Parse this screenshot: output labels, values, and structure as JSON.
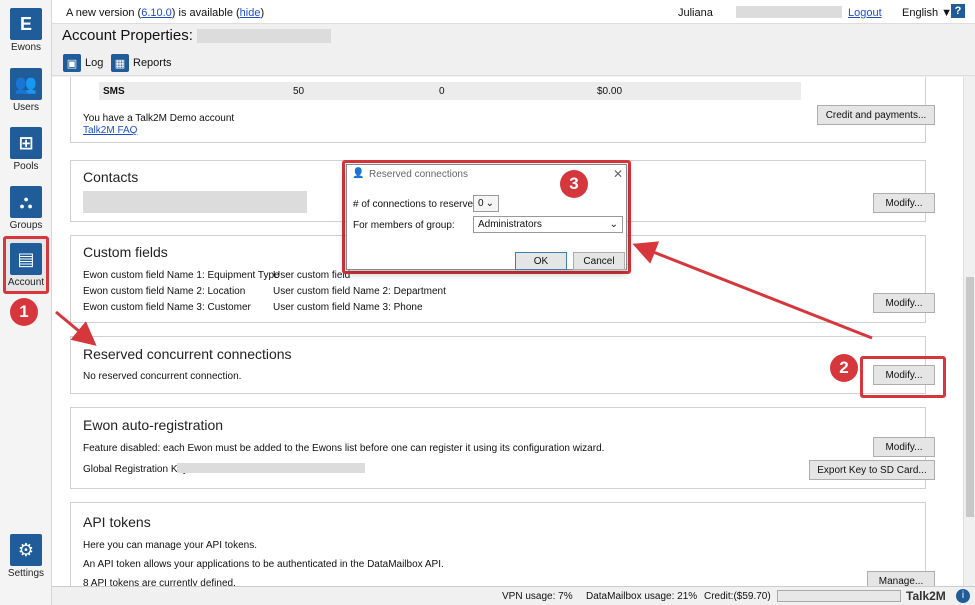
{
  "nav": [
    {
      "label": "Ewons",
      "icon": "ewons-logo-icon",
      "glyph": "E"
    },
    {
      "label": "Users",
      "icon": "users-icon",
      "glyph": "👥"
    },
    {
      "label": "Pools",
      "icon": "pools-icon",
      "glyph": "⊞"
    },
    {
      "label": "Groups",
      "icon": "groups-icon",
      "glyph": "⛬"
    },
    {
      "label": "Account",
      "icon": "account-icon",
      "glyph": "▤"
    },
    {
      "label": "Settings",
      "icon": "gear-icon",
      "glyph": "⚙"
    }
  ],
  "topbar": {
    "update_prefix": "A new version (",
    "version": "6.10.0",
    "update_suffix": ") is available (",
    "hide": "hide",
    "update_close": ")",
    "user": "Juliana",
    "logout": "Logout",
    "language": "English ▼",
    "help": "?"
  },
  "page_title": "Account Properties:",
  "toolbar": {
    "log": "Log",
    "reports": "Reports"
  },
  "sms_row": {
    "label": "SMS",
    "c1": "50",
    "c2": "0",
    "c3": "$0.00"
  },
  "talk2m": {
    "demo": "You have a Talk2M Demo account",
    "faq": "Talk2M FAQ",
    "credit_button": "Credit and payments..."
  },
  "contacts": {
    "title": "Contacts",
    "modify": "Modify..."
  },
  "custom_fields": {
    "title": "Custom fields",
    "ewon_fields": [
      "Ewon custom field Name 1: Equipment Type",
      "Ewon custom field Name 2: Location",
      "Ewon custom field Name 3: Customer"
    ],
    "user_fields": [
      "User custom field",
      "User custom field Name 2: Department",
      "User custom field Name 3: Phone"
    ],
    "modify": "Modify..."
  },
  "reserved": {
    "title": "Reserved concurrent connections",
    "text": "No reserved concurrent connection.",
    "modify": "Modify..."
  },
  "autoreg": {
    "title": "Ewon auto-registration",
    "text": "Feature disabled: each Ewon must be added to the Ewons list before one can register it using its configuration wizard.",
    "key_label": "Global Registration Key:",
    "modify": "Modify...",
    "export": "Export Key to SD Card..."
  },
  "api": {
    "title": "API tokens",
    "line1": "Here you can manage your API tokens.",
    "line2": "An API token allows your applications to be authenticated in the DataMailbox API.",
    "line3": "8 API tokens are currently defined.",
    "manage": "Manage..."
  },
  "dialog": {
    "title": "Reserved connections",
    "count_label": "# of connections to reserve:",
    "count_value": "0",
    "group_label": "For members of group:",
    "group_value": "Administrators",
    "ok": "OK",
    "cancel": "Cancel"
  },
  "callouts": [
    "1",
    "2",
    "3"
  ],
  "status": {
    "vpn": "VPN usage:   7%",
    "dmb": "DataMailbox usage:   21%",
    "credit": "Credit:($59.70)",
    "brand": "Talk2M"
  },
  "colors": {
    "accent": "#1f5c99",
    "highlight": "#d6373d"
  }
}
